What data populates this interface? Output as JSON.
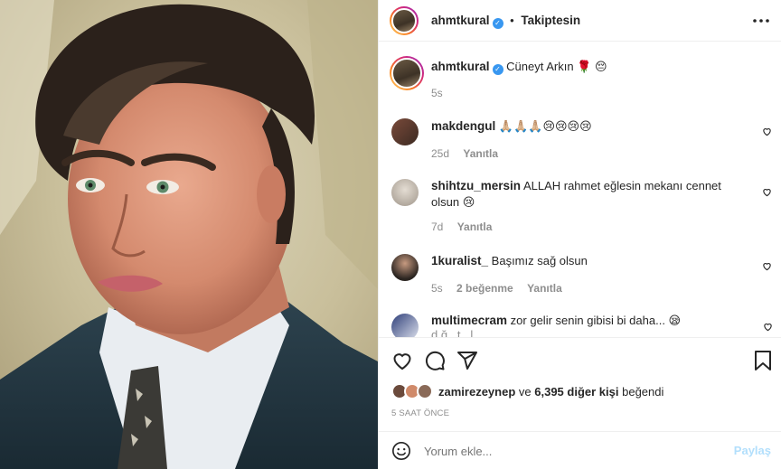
{
  "post": {
    "author": "ahmtkural",
    "follow_status": "Takiptesin",
    "separator": "•",
    "caption_user": "ahmtkural",
    "caption_text": "Cüneyt Arkın 🌹 😔",
    "caption_time": "5s"
  },
  "comments": [
    {
      "user": "makdengul",
      "text": "🙏🏼🙏🏼🙏🏼😢😢😢😢",
      "time": "25d",
      "likes": "",
      "reply": "Yanıtla"
    },
    {
      "user": "shihtzu_mersin",
      "text": "ALLAH rahmet eğlesin mekanı cennet olsun 😢",
      "time": "7d",
      "likes": "",
      "reply": "Yanıtla"
    },
    {
      "user": "1kuralist_",
      "text": "Başımız sağ olsun",
      "time": "5s",
      "likes": "2 beğenme",
      "reply": "Yanıtla"
    },
    {
      "user": "multimecram",
      "text": "zor gelir senin gibisi bi daha... 😪",
      "partial": "d ğ   t   l  ",
      "time": "",
      "likes": "",
      "reply": ""
    }
  ],
  "likes": {
    "liker": "zamirezeynep",
    "connector": "ve",
    "others": "6,395 diğer kişi",
    "suffix": "beğendi"
  },
  "timestamp": "5 SAAT ÖNCE",
  "add_comment": {
    "placeholder": "Yorum ekle...",
    "post_button": "Paylaş"
  },
  "icons": {
    "more": "more-options-icon",
    "heart": "heart-icon",
    "comment": "comment-icon",
    "share": "share-icon",
    "save": "bookmark-icon",
    "emoji": "emoji-icon"
  },
  "colors": {
    "link": "#3897f0",
    "muted": "#8e8e8e",
    "text": "#262626",
    "disabled_post": "#b2dffc"
  }
}
